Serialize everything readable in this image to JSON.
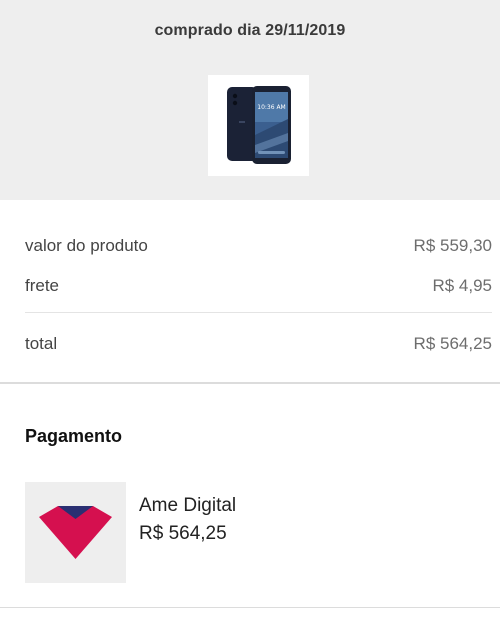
{
  "header": {
    "purchase_date": "comprado dia 29/11/2019",
    "product_image": "smartphone-image"
  },
  "summary": {
    "product_label": "valor do produto",
    "product_value": "R$ 559,30",
    "shipping_label": "frete",
    "shipping_value": "R$ 4,95",
    "total_label": "total",
    "total_value": "R$ 564,25"
  },
  "payment": {
    "title": "Pagamento",
    "method_name": "Ame Digital",
    "amount": "R$ 564,25",
    "logo_icon": "ame-heart-logo"
  },
  "colors": {
    "header_bg": "#eeeeee",
    "logo_magenta": "#d5104f",
    "logo_navy": "#2a2f72"
  }
}
